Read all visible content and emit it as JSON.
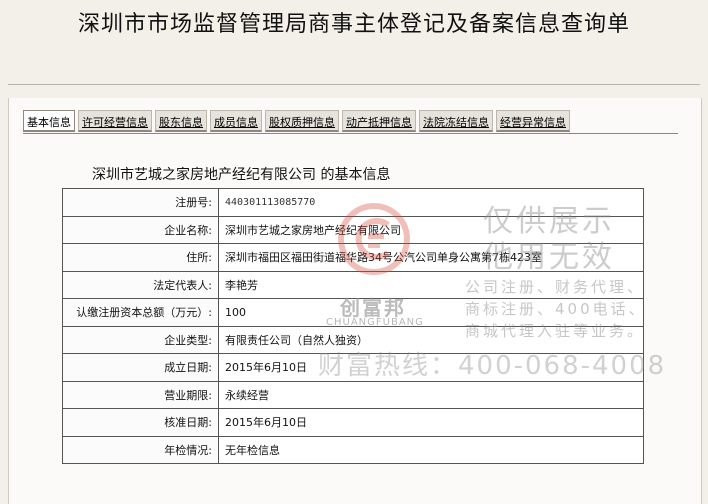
{
  "page_title": "深圳市市场监督管理局商事主体登记及备案信息查询单",
  "tabs": [
    "基本信息",
    "许可经营信息",
    "股东信息",
    "成员信息",
    "股权质押信息",
    "动产抵押信息",
    "法院冻结信息",
    "经营异常信息"
  ],
  "company_heading": "深圳市艺城之家房地产经纪有限公司 的基本信息",
  "rows": [
    {
      "label": "注册号:",
      "value": "440301113085770"
    },
    {
      "label": "企业名称:",
      "value": "深圳市艺城之家房地产经纪有限公司"
    },
    {
      "label": "住所:",
      "value": "深圳市福田区福田街道福华路34号公汽公司单身公寓第7栋423室"
    },
    {
      "label": "法定代表人:",
      "value": "李艳芳"
    },
    {
      "label": "认缴注册资本总额（万元）:",
      "value": "100"
    },
    {
      "label": "企业类型:",
      "value": "有限责任公司（自然人独资）"
    },
    {
      "label": "成立日期:",
      "value": "2015年6月10日"
    },
    {
      "label": "营业期限:",
      "value": "永续经营"
    },
    {
      "label": "核准日期:",
      "value": "2015年6月10日"
    },
    {
      "label": "年检情况:",
      "value": "无年检信息"
    }
  ],
  "watermark": {
    "brand": "创富邦",
    "brand_en": "CHUANGFUBANG",
    "line1": "仅供展示",
    "line2": "他用无效",
    "line3": "公司注册、财务代理、",
    "line4": "商标注册、400电话、",
    "line5": "商城代理入驻等业务。",
    "hotline": "财富热线：400-068-4008"
  }
}
